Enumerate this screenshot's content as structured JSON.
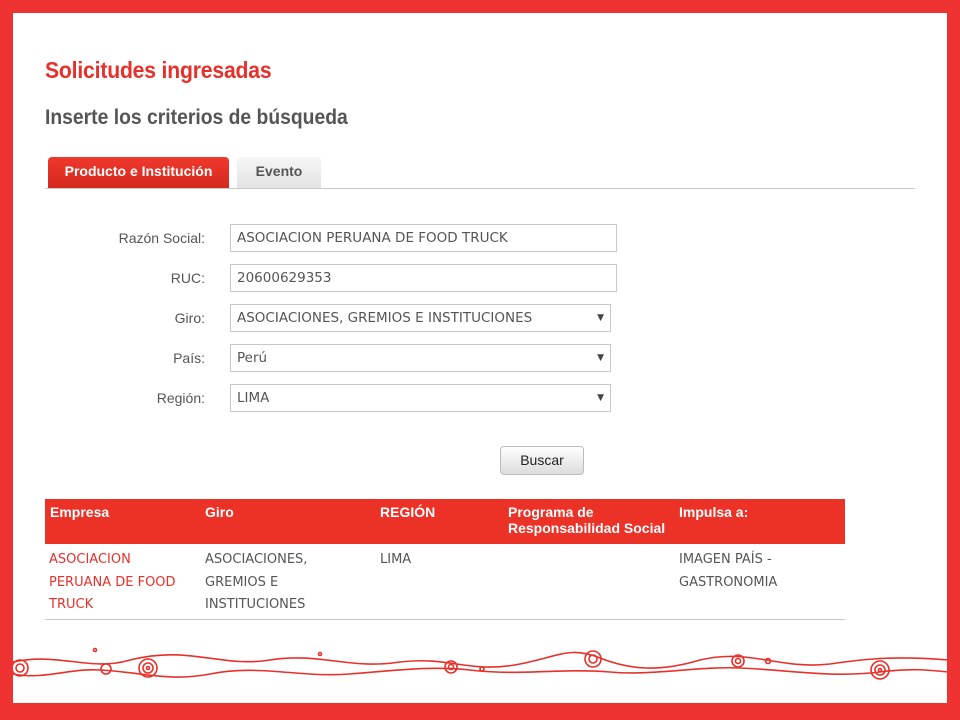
{
  "page": {
    "title": "Solicitudes ingresadas",
    "subtitle": "Inserte los criterios de búsqueda"
  },
  "tabs": [
    {
      "label": "Producto e Institución",
      "active": true
    },
    {
      "label": "Evento",
      "active": false
    }
  ],
  "form": {
    "razon_social": {
      "label": "Razón Social:",
      "value": "ASOCIACION PERUANA DE FOOD TRUCK"
    },
    "ruc": {
      "label": "RUC:",
      "value": "20600629353"
    },
    "giro": {
      "label": "Giro:",
      "value": "ASOCIACIONES, GREMIOS E INSTITUCIONES"
    },
    "pais": {
      "label": "País:",
      "value": "Perú"
    },
    "region": {
      "label": "Región:",
      "value": "LIMA"
    },
    "caret": "▼",
    "search_button": "Buscar"
  },
  "results": {
    "headers": [
      "Empresa",
      "Giro",
      "REGIÓN",
      "Programa de Responsabilidad Social",
      "Impulsa a:"
    ],
    "rows": [
      {
        "empresa": "ASOCIACION PERUANA DE FOOD TRUCK",
        "giro": "ASOCIACIONES, GREMIOS E INSTITUCIONES",
        "region": "LIMA",
        "programa": "",
        "impulsa": "IMAGEN PAÍS - GASTRONOMIA"
      }
    ]
  },
  "colors": {
    "brand_red": "#ee3131",
    "text_gray": "#555555"
  }
}
